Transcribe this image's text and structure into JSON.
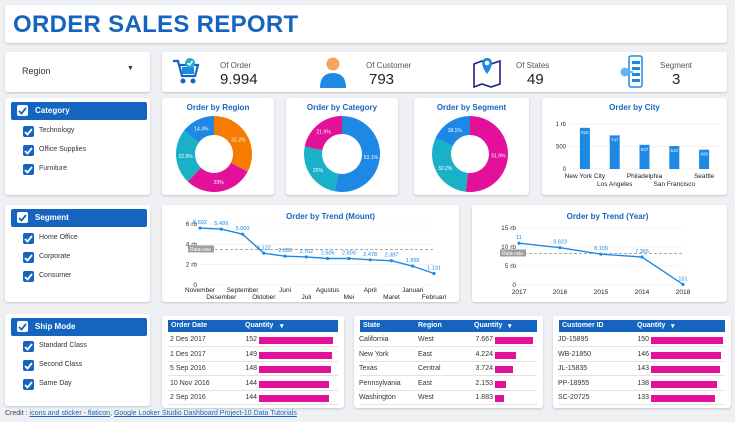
{
  "title": "ORDER SALES REPORT",
  "region": {
    "label": "Region"
  },
  "kpis": [
    {
      "label": "Of Order",
      "value": "9.994",
      "icon": "shopping-cart-icon"
    },
    {
      "label": "Of Customer",
      "value": "793",
      "icon": "person-icon"
    },
    {
      "label": "Of States",
      "value": "49",
      "icon": "map-pin-icon"
    },
    {
      "label": "Segment",
      "value": "3",
      "icon": "segment-network-icon"
    }
  ],
  "filters": {
    "category": {
      "header": "Category",
      "options": [
        "Technology",
        "Office Supplies",
        "Furniture"
      ]
    },
    "segment": {
      "header": "Segment",
      "options": [
        "Home Office",
        "Corporate",
        "Consumer"
      ]
    },
    "shipmode": {
      "header": "Ship Mode",
      "options": [
        "Standard Class",
        "Second Class",
        "Same Day"
      ]
    }
  },
  "colors": {
    "primary": "#1565c0",
    "bar": "#1e88e5",
    "magenta": "#e3109a",
    "cyan": "#1ab1c8",
    "orange": "#f57c00",
    "trend": "#1e88e5"
  },
  "chart_data": [
    {
      "type": "pie",
      "title": "Order by Region",
      "labels": [
        "",
        "",
        "",
        ""
      ],
      "values": [
        32.2,
        29,
        22.9,
        14.4
      ],
      "value_labels": [
        "32.2%",
        "29%",
        "22.9%",
        "14.4%"
      ],
      "colors": [
        "#f57c00",
        "#e3109a",
        "#1ab1c8",
        "#1e88e5"
      ]
    },
    {
      "type": "pie",
      "title": "Order by Category",
      "labels": [
        "",
        "",
        ""
      ],
      "values": [
        53.1,
        25,
        21.9
      ],
      "value_labels": [
        "53.1%",
        "25%",
        "21.9%"
      ],
      "colors": [
        "#1e88e5",
        "#1ab1c8",
        "#e3109a"
      ]
    },
    {
      "type": "pie",
      "title": "Order by Segment",
      "labels": [
        "",
        "",
        ""
      ],
      "values": [
        51.9,
        30.2,
        18.1
      ],
      "value_labels": [
        "51.9%",
        "30.2%",
        "18.1%"
      ],
      "colors": [
        "#e3109a",
        "#1ab1c8",
        "#1e88e5"
      ]
    },
    {
      "type": "bar",
      "title": "Order by City",
      "categories": [
        "New York City",
        "Los Angeles",
        "Philadelphia",
        "San Francisco",
        "Seattle"
      ],
      "values": [
        915,
        747,
        537,
        510,
        428
      ],
      "value_labels": [
        "915",
        "747",
        "537",
        "510",
        "428"
      ],
      "yticks": [
        "1 rb",
        "500",
        "0"
      ],
      "ylim": [
        0,
        1000
      ]
    },
    {
      "type": "line",
      "title": "Order by Trend (Mount)",
      "categories": [
        "November",
        "Desember",
        "September",
        "Oktober",
        "Juni",
        "Juli",
        "Agustus",
        "Mei",
        "April",
        "Maret",
        "Januari",
        "Februari"
      ],
      "values": [
        5602,
        5499,
        5000,
        3122,
        2836,
        2762,
        2606,
        2609,
        2478,
        2387,
        1855,
        1131
      ],
      "value_labels": [
        "5.602",
        "5.499",
        "5.000",
        "3.122",
        "2.836",
        "2.762",
        "2.606",
        "2.609",
        "2.478",
        "2.387",
        "1.855",
        "1.131"
      ],
      "yticks": [
        "6 rb",
        "4 rb",
        "2 rb",
        "0"
      ],
      "ylim": [
        0,
        6000
      ],
      "reference_label": "Rata-rata",
      "reference_value": 3500
    },
    {
      "type": "line",
      "title": "Order by Trend (Year)",
      "categories": [
        "2017",
        "2016",
        "2015",
        "2014",
        "2018"
      ],
      "values": [
        11000,
        9823,
        8109,
        7365,
        151
      ],
      "value_labels": [
        "11",
        "9.823",
        "8.109",
        "7.365",
        "151"
      ],
      "yticks": [
        "15 rb",
        "10 rb",
        "5 rb",
        "0"
      ],
      "ylim": [
        0,
        15000
      ],
      "reference_label": "Rata-rata",
      "reference_value": 8300
    }
  ],
  "tables": {
    "orders": {
      "headers": [
        "Order Date",
        "Quantity"
      ],
      "rows": [
        [
          "2 Des 2017",
          "152"
        ],
        [
          "1 Des 2017",
          "149"
        ],
        [
          "5 Sep 2016",
          "148"
        ],
        [
          "10 Nov 2016",
          "144"
        ],
        [
          "2 Sep 2016",
          "144"
        ]
      ],
      "fill": [
        1,
        0.98,
        0.974,
        0.947,
        0.947
      ]
    },
    "states": {
      "headers": [
        "State",
        "Region",
        "Quantity"
      ],
      "rows": [
        [
          "California",
          "West",
          "7.667"
        ],
        [
          "New York",
          "East",
          "4.224"
        ],
        [
          "Texas",
          "Central",
          "3.724"
        ],
        [
          "Pennsylvania",
          "East",
          "2.153"
        ],
        [
          "Washington",
          "West",
          "1.883"
        ]
      ],
      "fill": [
        1,
        0.551,
        0.486,
        0.281,
        0.246
      ]
    },
    "customers": {
      "headers": [
        "Customer ID",
        "Quantity"
      ],
      "rows": [
        [
          "JD-15895",
          "150"
        ],
        [
          "WB-21850",
          "146"
        ],
        [
          "JL-15835",
          "143"
        ],
        [
          "PP-18955",
          "138"
        ],
        [
          "SC-20725",
          "133"
        ]
      ],
      "fill": [
        1,
        0.973,
        0.953,
        0.92,
        0.887
      ]
    }
  },
  "credit": {
    "prefix": "Credit : ",
    "link1": "icons and sticker - flaticon",
    "sep": ", ",
    "link2": "Google Looker Studio Dashboard Project-10 Data Tutorials"
  }
}
